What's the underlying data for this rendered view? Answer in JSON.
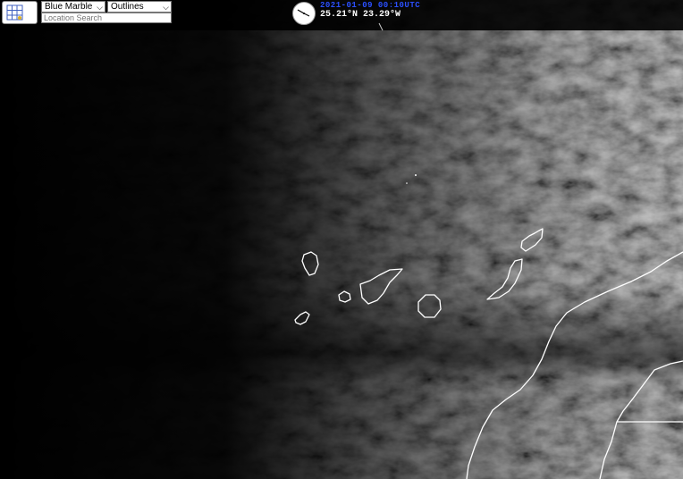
{
  "toolbar": {
    "grid_icon": "grid-icon",
    "basemap_select": {
      "value": "Blue Marble"
    },
    "overlay_select": {
      "value": "Outlines"
    },
    "search": {
      "placeholder": "Location Search",
      "value": ""
    }
  },
  "status": {
    "timestamp": "2021-01-09 00:10UTC",
    "coordinates": "25.21°N 23.29°W",
    "clock_icon": "clock-icon"
  },
  "colors": {
    "coastline": "#ffffff",
    "timestamp": "#2b50ff",
    "background": "#000000"
  }
}
